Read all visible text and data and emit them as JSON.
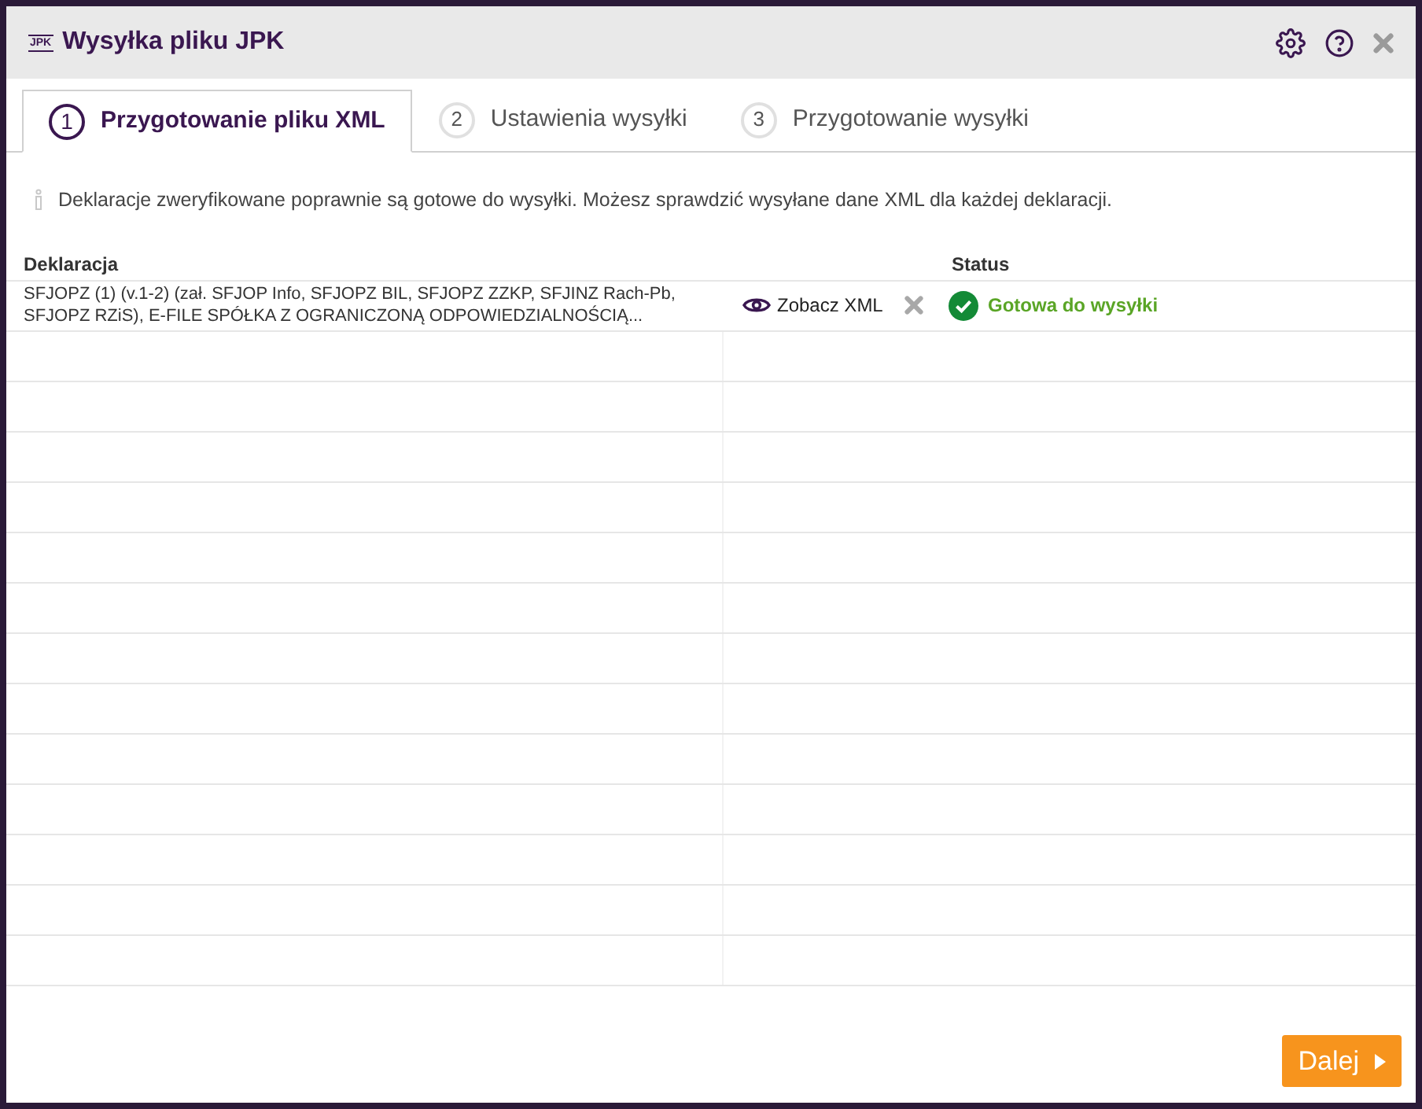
{
  "window": {
    "logo": "JPK",
    "title": "Wysyłka pliku JPK"
  },
  "tabs": [
    {
      "number": "1",
      "label": "Przygotowanie pliku XML",
      "selected": true
    },
    {
      "number": "2",
      "label": "Ustawienia wysyłki",
      "selected": false
    },
    {
      "number": "3",
      "label": "Przygotowanie wysyłki",
      "selected": false
    }
  ],
  "info": "Deklaracje zweryfikowane poprawnie są gotowe do wysyłki. Możesz sprawdzić wysyłane dane XML dla każdej deklaracji.",
  "table": {
    "columns": [
      "Deklaracja",
      "Status"
    ],
    "rows": [
      {
        "declaration": "SFJOPZ (1) (v.1-2) (zał. SFJOP Info, SFJOPZ BIL, SFJOPZ ZZKP, SFJINZ Rach-Pb, SFJOPZ RZiS), E-FILE SPÓŁKA Z OGRANICZONĄ ODPOWIEDZIALNOŚCIĄ...",
        "view": "Zobacz XML",
        "status": "Gotowa do wysyłki",
        "ready": true
      }
    ]
  },
  "buttons": {
    "next": "Dalej"
  }
}
